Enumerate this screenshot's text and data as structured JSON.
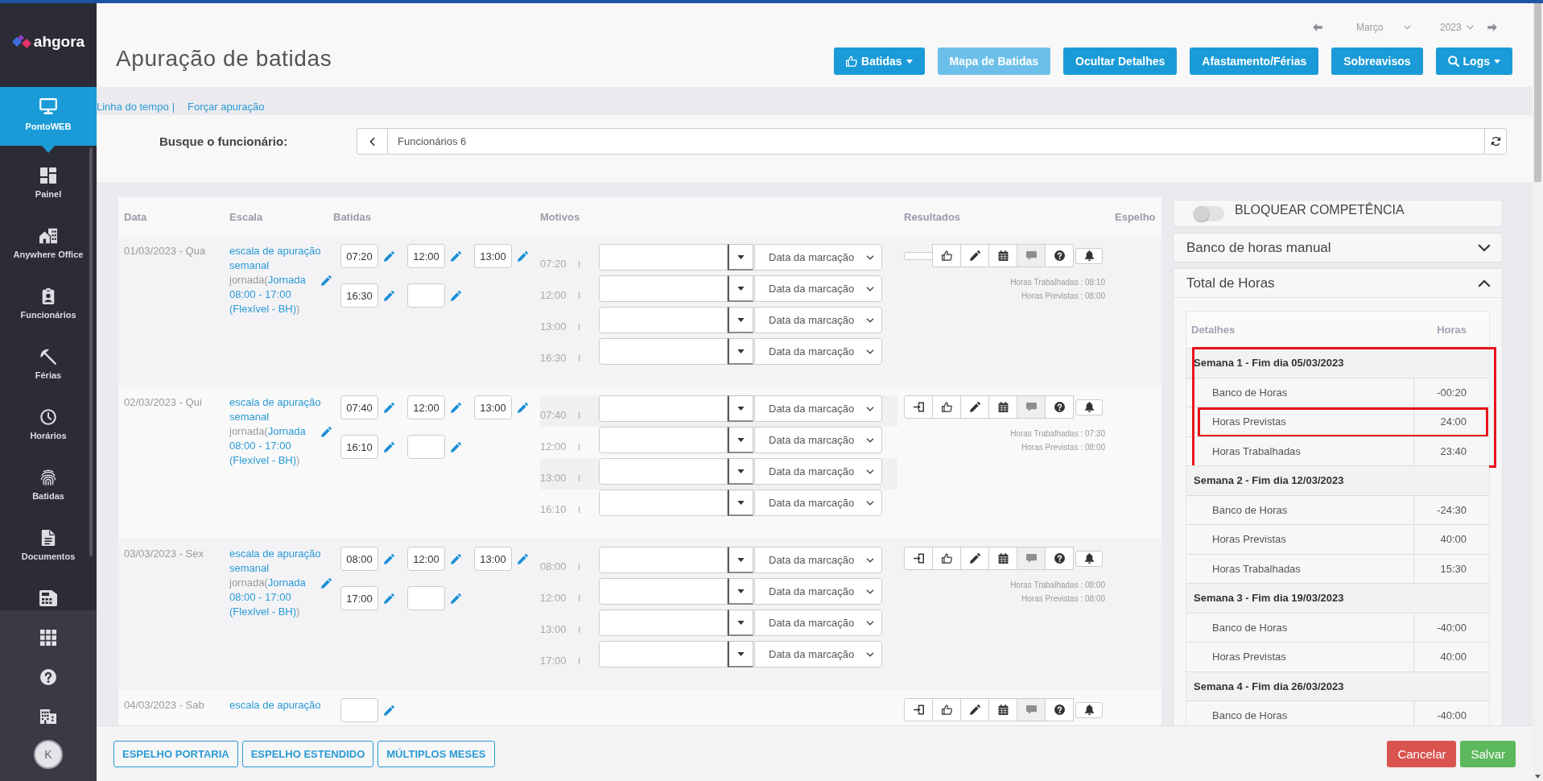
{
  "brand": {
    "name": "ahgora"
  },
  "sidebar": {
    "items": [
      {
        "kind": "timesheet",
        "label": "PontoWEB",
        "selected": true
      },
      {
        "kind": "dashboard",
        "label": "Painel",
        "selected": false
      },
      {
        "kind": "remote",
        "label": "Anywhere Office",
        "selected": false
      },
      {
        "kind": "staff",
        "label": "Funcionários",
        "selected": false
      },
      {
        "kind": "vacation",
        "label": "Férias",
        "selected": false
      },
      {
        "kind": "schedule",
        "label": "Horários",
        "selected": false
      },
      {
        "kind": "punches",
        "label": "Batidas",
        "selected": false
      },
      {
        "kind": "documents",
        "label": "Documentos",
        "selected": false
      },
      {
        "kind": "reports",
        "selected": false
      }
    ],
    "tools": [
      {
        "kind": "apps"
      },
      {
        "kind": "help"
      },
      {
        "kind": "company"
      }
    ],
    "user": {
      "initial": "K"
    }
  },
  "header": {
    "title": "Apuração de batidas",
    "period": {
      "month": "Março",
      "year": "2023"
    },
    "actions": [
      {
        "label": "Batidas",
        "kind": "like-menu",
        "disabled": false
      },
      {
        "label": "Mapa de Batidas",
        "kind": "plain",
        "disabled": true
      },
      {
        "label": "Ocultar Detalhes",
        "kind": "plain",
        "disabled": false
      },
      {
        "label": "Afastamento/Férias",
        "kind": "plain",
        "disabled": false
      },
      {
        "label": "Sobreavisos",
        "kind": "plain",
        "disabled": false
      },
      {
        "label": "Logs",
        "kind": "search-menu",
        "disabled": false
      }
    ]
  },
  "subnav": {
    "links": [
      "Linha do tempo",
      "Forçar apuração"
    ],
    "separator": "|"
  },
  "search": {
    "label": "Busque o funcionário:",
    "value": "Funcionários 6"
  },
  "table": {
    "columns": [
      "Data",
      "Escala",
      "Batidas",
      "Motivos",
      "Resultados",
      "Espelho"
    ],
    "rows": [
      {
        "date": "01/03/2023 - Qua",
        "escala": "escala de apuração semanal",
        "jornada": {
          "prefix": "jornada(",
          "name": "Jornada 08:00 - 17:00 (Flexível - BH)",
          "suffix": ")"
        },
        "batidas": [
          "07:20",
          "12:00",
          "13:00",
          "16:30"
        ],
        "open_slot": true,
        "motivos": [
          {
            "time": "07:20",
            "mark": "I",
            "option": "Data da marcação"
          },
          {
            "time": "12:00",
            "mark": "I",
            "option": "Data da marcação"
          },
          {
            "time": "13:00",
            "mark": "I",
            "option": "Data da marcação"
          },
          {
            "time": "16:30",
            "mark": "I",
            "option": "Data da marcação"
          }
        ],
        "actions": [
          {
            "kind": "blank",
            "disabled": false
          },
          {
            "kind": "like",
            "disabled": false
          },
          {
            "kind": "edit",
            "disabled": false
          },
          {
            "kind": "calendar",
            "disabled": false
          },
          {
            "kind": "comment",
            "disabled": true
          },
          {
            "kind": "help",
            "disabled": false
          },
          {
            "kind": "alert",
            "disabled": false
          }
        ],
        "hours": [
          "Horas Trabalhadas : 08:10",
          "Horas Previstas : 08:00"
        ]
      },
      {
        "date": "02/03/2023 - Qui",
        "escala": "escala de apuração semanal",
        "jornada": {
          "prefix": "jornada(",
          "name": "Jornada 08:00 - 17:00 (Flexível - BH)",
          "suffix": ")"
        },
        "batidas": [
          "07:40",
          "12:00",
          "13:00",
          "16:10"
        ],
        "open_slot": true,
        "motivos": [
          {
            "time": "07:40",
            "mark": "I",
            "option": "Data da marcação"
          },
          {
            "time": "12:00",
            "mark": "I",
            "option": "Data da marcação"
          },
          {
            "time": "13:00",
            "mark": "I",
            "option": "Data da marcação"
          },
          {
            "time": "16:10",
            "mark": "I",
            "option": "Data da marcação"
          }
        ],
        "actions": [
          {
            "kind": "exit",
            "disabled": false
          },
          {
            "kind": "like",
            "disabled": false
          },
          {
            "kind": "edit",
            "disabled": false
          },
          {
            "kind": "calendar",
            "disabled": false
          },
          {
            "kind": "comment",
            "disabled": true
          },
          {
            "kind": "help",
            "disabled": false
          },
          {
            "kind": "alert",
            "disabled": false
          }
        ],
        "hours": [
          "Horas Trabalhadas : 07:30",
          "Horas Previstas : 08:00"
        ]
      },
      {
        "date": "03/03/2023 - Sex",
        "escala": "escala de apuração semanal",
        "jornada": {
          "prefix": "jornada(",
          "name": "Jornada 08:00 - 17:00 (Flexível - BH)",
          "suffix": ")"
        },
        "batidas": [
          "08:00",
          "12:00",
          "13:00",
          "17:00"
        ],
        "open_slot": true,
        "motivos": [
          {
            "time": "08:00",
            "mark": "I",
            "option": "Data da marcação"
          },
          {
            "time": "12:00",
            "mark": "I",
            "option": "Data da marcação"
          },
          {
            "time": "13:00",
            "mark": "I",
            "option": "Data da marcação"
          },
          {
            "time": "17:00",
            "mark": "I",
            "option": "Data da marcação"
          }
        ],
        "actions": [
          {
            "kind": "exit",
            "disabled": false
          },
          {
            "kind": "like",
            "disabled": false
          },
          {
            "kind": "edit",
            "disabled": false
          },
          {
            "kind": "calendar",
            "disabled": false
          },
          {
            "kind": "comment",
            "disabled": true
          },
          {
            "kind": "help",
            "disabled": false
          },
          {
            "kind": "alert",
            "disabled": false
          }
        ],
        "hours": [
          "Horas Trabalhadas : 08:00",
          "Horas Previstas : 08:00"
        ]
      },
      {
        "date": "04/03/2023 - Sab",
        "escala": "escala de apuração",
        "open_slot": true,
        "actions": [
          {
            "kind": "exit",
            "disabled": false
          },
          {
            "kind": "like",
            "disabled": false
          },
          {
            "kind": "edit",
            "disabled": false
          },
          {
            "kind": "calendar",
            "disabled": false
          },
          {
            "kind": "comment",
            "disabled": true
          },
          {
            "kind": "help",
            "disabled": false
          },
          {
            "kind": "alert",
            "disabled": false
          }
        ]
      }
    ]
  },
  "lock": {
    "label": "BLOQUEAR COMPETÊNCIA",
    "on": false
  },
  "manual_bank": {
    "title": "Banco de horas manual",
    "expanded": false
  },
  "totals": {
    "title": "Total de Horas",
    "expanded": true,
    "columns": [
      "Detalhes",
      "Horas"
    ],
    "weeks": [
      {
        "title": "Semana 1 - Fim dia 05/03/2023",
        "highlighted": true,
        "rows": [
          {
            "label": "Banco de Horas",
            "value": "-00:20",
            "highlighted": false
          },
          {
            "label": "Horas Previstas",
            "value": "24:00",
            "highlighted": true
          },
          {
            "label": "Horas Trabalhadas",
            "value": "23:40",
            "highlighted": false
          }
        ]
      },
      {
        "title": "Semana 2 - Fim dia 12/03/2023",
        "highlighted": false,
        "rows": [
          {
            "label": "Banco de Horas",
            "value": "-24:30",
            "highlighted": false
          },
          {
            "label": "Horas Previstas",
            "value": "40:00",
            "highlighted": false
          },
          {
            "label": "Horas Trabalhadas",
            "value": "15:30",
            "highlighted": false
          }
        ]
      },
      {
        "title": "Semana 3 - Fim dia 19/03/2023",
        "highlighted": false,
        "rows": [
          {
            "label": "Banco de Horas",
            "value": "-40:00",
            "highlighted": false
          },
          {
            "label": "Horas Previstas",
            "value": "40:00",
            "highlighted": false
          }
        ]
      },
      {
        "title": "Semana 4 - Fim dia 26/03/2023",
        "highlighted": false,
        "rows": [
          {
            "label": "Banco de Horas",
            "value": "-40:00",
            "highlighted": false
          }
        ]
      }
    ]
  },
  "footer": {
    "reports": [
      "ESPELHO PORTARIA",
      "ESPELHO ESTENDIDO",
      "MÚLTIPLOS MESES"
    ],
    "actions": [
      {
        "label": "Cancelar",
        "kind": "danger"
      },
      {
        "label": "Salvar",
        "kind": "success"
      }
    ]
  }
}
